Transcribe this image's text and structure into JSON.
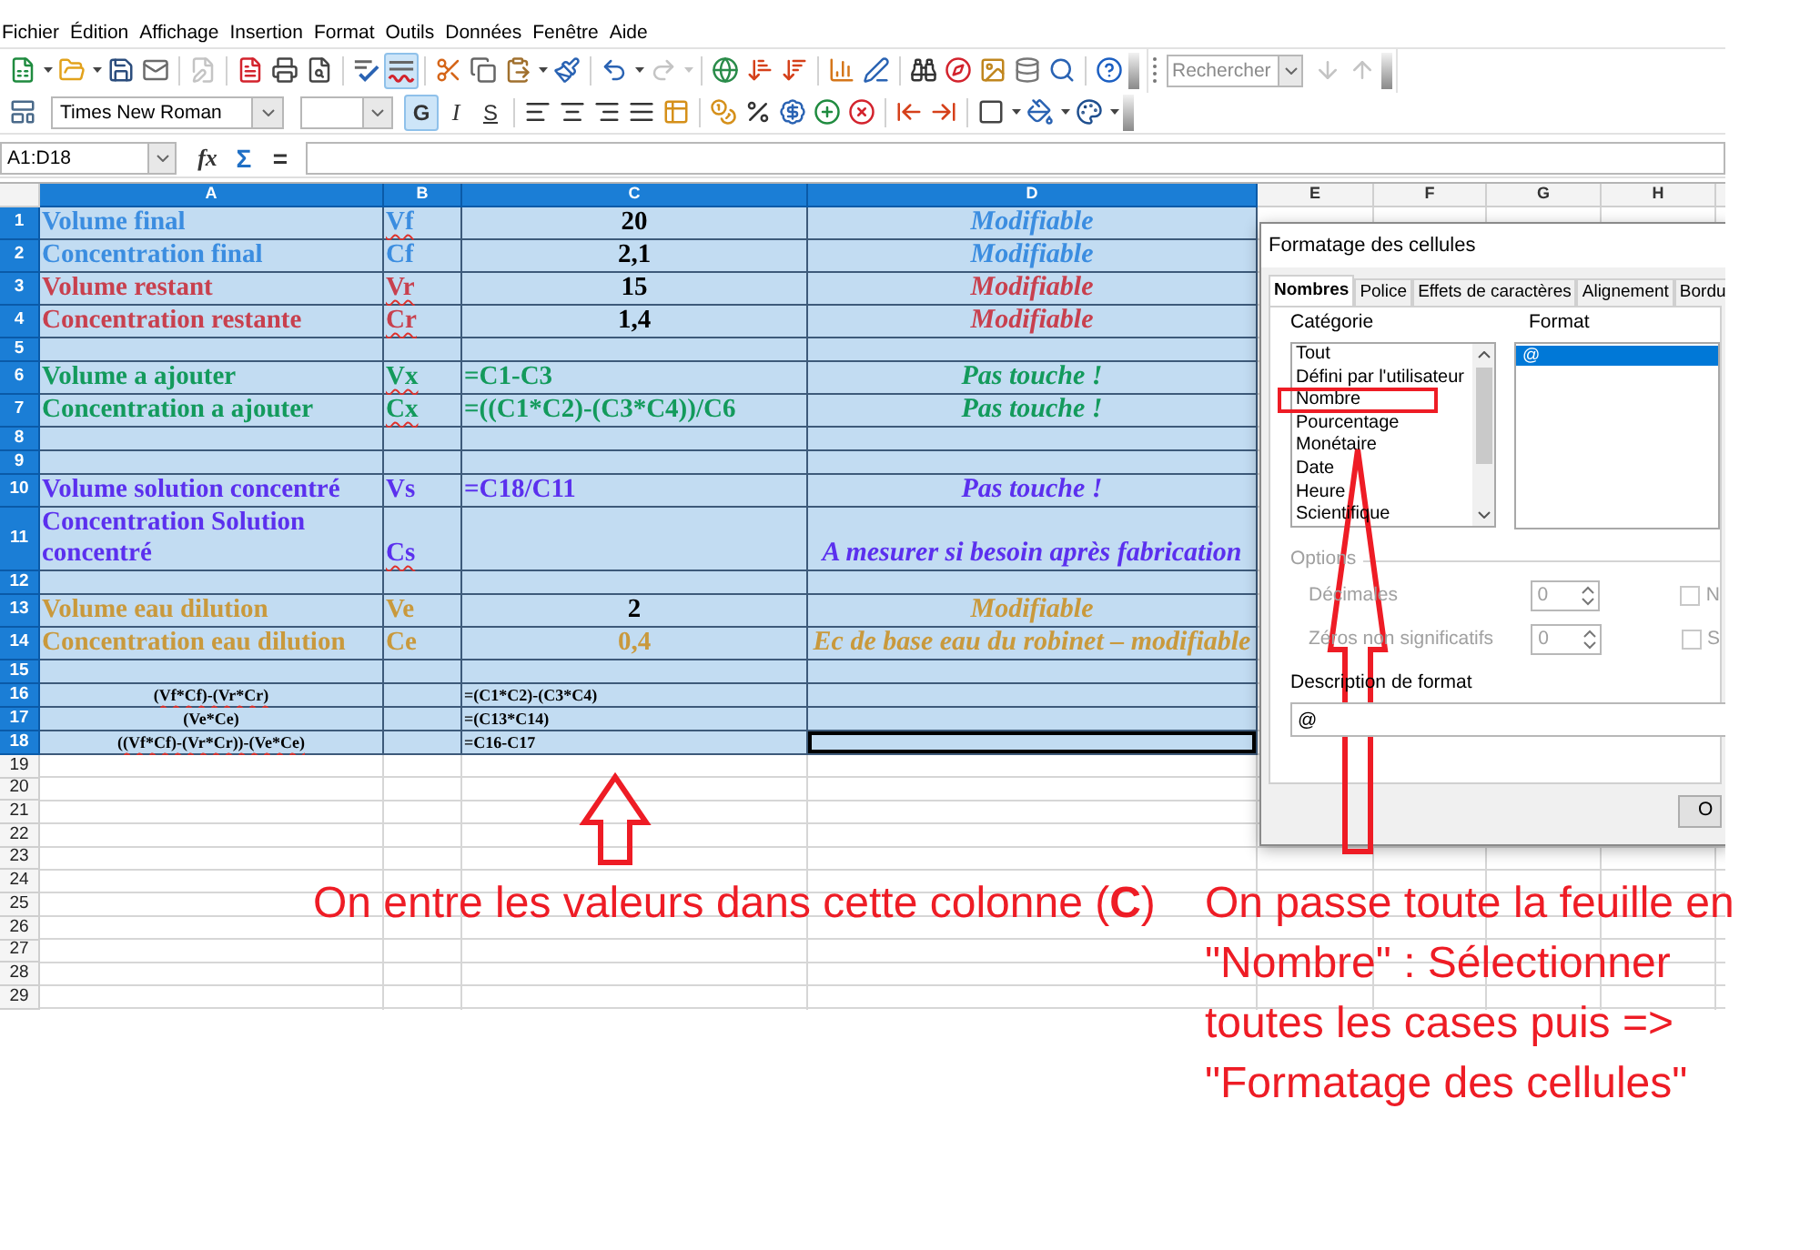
{
  "menu": [
    "Fichier",
    "Édition",
    "Affichage",
    "Insertion",
    "Format",
    "Outils",
    "Données",
    "Fenêtre",
    "Aide"
  ],
  "standard_toolbar": {
    "buttons": [
      {
        "active": false,
        "disabled": false
      },
      {
        "active": false,
        "disabled": false
      },
      {
        "active": false,
        "disabled": false
      },
      {
        "active": false,
        "disabled": false
      },
      {
        "active": false,
        "disabled": true
      },
      {
        "active": false,
        "disabled": false
      },
      {
        "active": false,
        "disabled": false
      },
      {
        "active": false,
        "disabled": false
      },
      {
        "active": false,
        "disabled": false
      },
      {
        "active": true,
        "disabled": false
      },
      {
        "active": false,
        "disabled": false
      },
      {
        "active": false,
        "disabled": false
      },
      {
        "active": false,
        "disabled": false
      },
      {
        "active": false,
        "disabled": false
      },
      {
        "active": false,
        "disabled": false
      },
      {
        "active": false,
        "disabled": true
      },
      {
        "active": false,
        "disabled": false
      },
      {
        "active": false,
        "disabled": false
      },
      {
        "active": false,
        "disabled": false
      },
      {
        "active": false,
        "disabled": false
      },
      {
        "active": false,
        "disabled": false
      },
      {
        "active": false,
        "disabled": false
      },
      {
        "active": false,
        "disabled": false
      },
      {
        "active": false,
        "disabled": false
      },
      {
        "active": false,
        "disabled": false
      },
      {
        "active": false,
        "disabled": false
      },
      {
        "active": false,
        "disabled": false
      }
    ]
  },
  "find_toolbar": {
    "placeholder": "Rechercher",
    "buttons": [
      {
        "disabled": true
      },
      {
        "disabled": true
      }
    ]
  },
  "formatting_toolbar": {
    "font_name": "Times New Roman",
    "style_buttons": [
      {
        "label": "G",
        "active": true
      },
      {
        "label": "I",
        "active": false
      },
      {
        "label": "S",
        "active": false
      }
    ]
  },
  "formula_bar": {
    "name_box": "A1:D18",
    "buttons": [
      {
        "label": "fx"
      },
      {
        "label": "Σ"
      },
      {
        "label": "="
      }
    ]
  },
  "sheet": {
    "columns": [
      {
        "label": "A",
        "selected": true
      },
      {
        "label": "B",
        "selected": true
      },
      {
        "label": "C",
        "selected": true
      },
      {
        "label": "D",
        "selected": true
      },
      {
        "label": "E",
        "selected": false
      },
      {
        "label": "F",
        "selected": false
      },
      {
        "label": "G",
        "selected": false
      },
      {
        "label": "H",
        "selected": false
      }
    ],
    "rows": [
      {
        "header": "1",
        "selected": true,
        "kind": "entry",
        "cells": [
          {
            "kind": "label",
            "text": "Volume final",
            "color": "#3b8de0",
            "flagged": false,
            "active": false
          },
          {
            "kind": "symbol",
            "text": "Vf",
            "color": "#3b8de0",
            "flagged": true,
            "active": false
          },
          {
            "kind": "value",
            "text": "20",
            "color": "#000000",
            "flagged": false,
            "active": false
          },
          {
            "kind": "note",
            "text": "Modifiable",
            "color": "#3b8de0",
            "flagged": false,
            "active": false
          }
        ]
      },
      {
        "header": "2",
        "selected": true,
        "kind": "entry",
        "cells": [
          {
            "kind": "label",
            "text": "Concentration final",
            "color": "#3b8de0",
            "flagged": false,
            "active": false
          },
          {
            "kind": "symbol",
            "text": "Cf",
            "color": "#3b8de0",
            "flagged": false,
            "active": false
          },
          {
            "kind": "value",
            "text": "2,1",
            "color": "#000000",
            "flagged": false,
            "active": false
          },
          {
            "kind": "note",
            "text": "Modifiable",
            "color": "#3b8de0",
            "flagged": false,
            "active": false
          }
        ]
      },
      {
        "header": "3",
        "selected": true,
        "kind": "entry",
        "cells": [
          {
            "kind": "label",
            "text": "Volume restant",
            "color": "#c8404e",
            "flagged": false,
            "active": false
          },
          {
            "kind": "symbol",
            "text": "Vr",
            "color": "#c8404e",
            "flagged": true,
            "active": false
          },
          {
            "kind": "value",
            "text": "15",
            "color": "#000000",
            "flagged": false,
            "active": false
          },
          {
            "kind": "note",
            "text": "Modifiable",
            "color": "#c8404e",
            "flagged": false,
            "active": false
          }
        ]
      },
      {
        "header": "4",
        "selected": true,
        "kind": "entry",
        "cells": [
          {
            "kind": "label",
            "text": "Concentration restante",
            "color": "#c8404e",
            "flagged": false,
            "active": false
          },
          {
            "kind": "symbol",
            "text": "Cr",
            "color": "#c8404e",
            "flagged": true,
            "active": false
          },
          {
            "kind": "value",
            "text": "1,4",
            "color": "#000000",
            "flagged": false,
            "active": false
          },
          {
            "kind": "note",
            "text": "Modifiable",
            "color": "#c8404e",
            "flagged": false,
            "active": false
          }
        ]
      },
      {
        "header": "5",
        "selected": true,
        "kind": "blank",
        "cells": [
          {
            "kind": "empty",
            "active": false
          },
          {
            "kind": "empty",
            "active": false
          },
          {
            "kind": "empty",
            "active": false
          },
          {
            "kind": "empty",
            "active": false
          }
        ]
      },
      {
        "header": "6",
        "selected": true,
        "kind": "entry",
        "cells": [
          {
            "kind": "label",
            "text": "Volume a ajouter",
            "color": "#139a5c",
            "flagged": false,
            "active": false
          },
          {
            "kind": "symbol",
            "text": "Vx",
            "color": "#139a5c",
            "flagged": true,
            "active": false
          },
          {
            "kind": "formula",
            "text": "=C1-C3",
            "color": "#139a5c",
            "flagged": false,
            "active": false
          },
          {
            "kind": "note",
            "text": "Pas touche !",
            "color": "#139a5c",
            "flagged": false,
            "active": false
          }
        ]
      },
      {
        "header": "7",
        "selected": true,
        "kind": "entry",
        "cells": [
          {
            "kind": "label",
            "text": "Concentration a ajouter",
            "color": "#139a5c",
            "flagged": false,
            "active": false
          },
          {
            "kind": "symbol",
            "text": "Cx",
            "color": "#139a5c",
            "flagged": true,
            "active": false
          },
          {
            "kind": "formula",
            "text": "=((C1*C2)-(C3*C4))/C6",
            "color": "#139a5c",
            "flagged": false,
            "active": false
          },
          {
            "kind": "note",
            "text": "Pas touche !",
            "color": "#139a5c",
            "flagged": false,
            "active": false
          }
        ]
      },
      {
        "header": "8",
        "selected": true,
        "kind": "blank",
        "cells": [
          {
            "kind": "empty",
            "active": false
          },
          {
            "kind": "empty",
            "active": false
          },
          {
            "kind": "empty",
            "active": false
          },
          {
            "kind": "empty",
            "active": false
          }
        ]
      },
      {
        "header": "9",
        "selected": true,
        "kind": "blank",
        "cells": [
          {
            "kind": "empty",
            "active": false
          },
          {
            "kind": "empty",
            "active": false
          },
          {
            "kind": "empty",
            "active": false
          },
          {
            "kind": "empty",
            "active": false
          }
        ]
      },
      {
        "header": "10",
        "selected": true,
        "kind": "entry",
        "cells": [
          {
            "kind": "label",
            "text": "Volume solution concentré",
            "color": "#5b30ee",
            "flagged": false,
            "active": false
          },
          {
            "kind": "symbol",
            "text": "Vs",
            "color": "#5b30ee",
            "flagged": false,
            "active": false
          },
          {
            "kind": "formula",
            "text": "=C18/C11",
            "color": "#5b30ee",
            "flagged": false,
            "active": false
          },
          {
            "kind": "note",
            "text": "Pas touche !",
            "color": "#5b30ee",
            "flagged": false,
            "active": false
          }
        ]
      },
      {
        "header": "11",
        "selected": true,
        "kind": "entry",
        "cells": [
          {
            "kind": "label",
            "text": "Concentration Solution concentré",
            "color": "#5b30ee",
            "flagged": false,
            "active": false
          },
          {
            "kind": "symbol",
            "text": "Cs",
            "color": "#5b30ee",
            "flagged": true,
            "active": false
          },
          {
            "kind": "empty",
            "active": false
          },
          {
            "kind": "note",
            "text": "A mesurer si besoin après fabrication",
            "color": "#5b30ee",
            "flagged": false,
            "active": false
          }
        ]
      },
      {
        "header": "12",
        "selected": true,
        "kind": "blank",
        "cells": [
          {
            "kind": "empty",
            "active": false
          },
          {
            "kind": "empty",
            "active": false
          },
          {
            "kind": "empty",
            "active": false
          },
          {
            "kind": "empty",
            "active": false
          }
        ]
      },
      {
        "header": "13",
        "selected": true,
        "kind": "entry",
        "cells": [
          {
            "kind": "label",
            "text": "Volume eau dilution",
            "color": "#c9993c",
            "flagged": false,
            "active": false
          },
          {
            "kind": "symbol",
            "text": "Ve",
            "color": "#c9993c",
            "flagged": false,
            "active": false
          },
          {
            "kind": "value",
            "text": "2",
            "color": "#000000",
            "flagged": false,
            "active": false
          },
          {
            "kind": "note",
            "text": "Modifiable",
            "color": "#c9993c",
            "flagged": false,
            "active": false
          }
        ]
      },
      {
        "header": "14",
        "selected": true,
        "kind": "entry",
        "cells": [
          {
            "kind": "label",
            "text": "Concentration eau dilution",
            "color": "#c9993c",
            "flagged": false,
            "active": false
          },
          {
            "kind": "symbol",
            "text": "Ce",
            "color": "#c9993c",
            "flagged": false,
            "active": false
          },
          {
            "kind": "value",
            "text": "0,4",
            "color": "#c9993c",
            "flagged": false,
            "active": false
          },
          {
            "kind": "note",
            "text": "Ec de base eau du robinet – modifiable",
            "color": "#c9993c",
            "flagged": false,
            "active": false
          }
        ]
      },
      {
        "header": "15",
        "selected": true,
        "kind": "blank",
        "cells": [
          {
            "kind": "empty",
            "active": false
          },
          {
            "kind": "empty",
            "active": false
          },
          {
            "kind": "empty",
            "active": false
          },
          {
            "kind": "empty",
            "active": false
          }
        ]
      },
      {
        "header": "16",
        "selected": true,
        "kind": "calc",
        "cells": [
          {
            "kind": "expression",
            "text": "(Vf*Cf)-(Vr*Cr)",
            "color": "#000000",
            "flagged": true,
            "active": false
          },
          {
            "kind": "empty",
            "active": false
          },
          {
            "kind": "formula",
            "text": "=(C1*C2)-(C3*C4)",
            "color": "#000000",
            "flagged": false,
            "active": false
          },
          {
            "kind": "empty",
            "active": false
          }
        ]
      },
      {
        "header": "17",
        "selected": true,
        "kind": "calc",
        "cells": [
          {
            "kind": "expression",
            "text": "(Ve*Ce)",
            "color": "#000000",
            "flagged": false,
            "active": false
          },
          {
            "kind": "empty",
            "active": false
          },
          {
            "kind": "formula",
            "text": "=(C13*C14)",
            "color": "#000000",
            "flagged": false,
            "active": false
          },
          {
            "kind": "empty",
            "active": false
          }
        ]
      },
      {
        "header": "18",
        "selected": true,
        "kind": "calc",
        "cells": [
          {
            "kind": "expression",
            "text": "((Vf*Cf)-(Vr*Cr))-(Ve*Ce)",
            "color": "#000000",
            "flagged": true,
            "active": false
          },
          {
            "kind": "empty",
            "active": false
          },
          {
            "kind": "formula",
            "text": "=C16-C17",
            "color": "#000000",
            "flagged": false,
            "active": false
          },
          {
            "kind": "empty",
            "active": true
          }
        ]
      },
      {
        "header": "19",
        "selected": false,
        "kind": "empty"
      },
      {
        "header": "20",
        "selected": false,
        "kind": "empty"
      },
      {
        "header": "21",
        "selected": false,
        "kind": "empty"
      },
      {
        "header": "22",
        "selected": false,
        "kind": "empty"
      },
      {
        "header": "23",
        "selected": false,
        "kind": "empty"
      },
      {
        "header": "24",
        "selected": false,
        "kind": "empty"
      },
      {
        "header": "25",
        "selected": false,
        "kind": "empty"
      },
      {
        "header": "26",
        "selected": false,
        "kind": "empty"
      },
      {
        "header": "27",
        "selected": false,
        "kind": "empty"
      },
      {
        "header": "28",
        "selected": false,
        "kind": "empty"
      },
      {
        "header": "29",
        "selected": false,
        "kind": "empty"
      }
    ]
  },
  "dialog": {
    "title": "Formatage des cellules",
    "tabs": [
      {
        "label": "Nombres",
        "selected": true
      },
      {
        "label": "Police",
        "selected": false
      },
      {
        "label": "Effets de caractères",
        "selected": false
      },
      {
        "label": "Alignement",
        "selected": false
      },
      {
        "label": "Bordu",
        "selected": false
      }
    ],
    "category": {
      "label": "Catégorie",
      "items": [
        {
          "label": "Tout",
          "selected": false
        },
        {
          "label": "Défini par l'utilisateur",
          "selected": false
        },
        {
          "label": "Nombre",
          "selected": false
        },
        {
          "label": "Pourcentage",
          "selected": false
        },
        {
          "label": "Monétaire",
          "selected": false
        },
        {
          "label": "Date",
          "selected": false
        },
        {
          "label": "Heure",
          "selected": false
        },
        {
          "label": "Scientifique",
          "selected": false
        }
      ]
    },
    "format": {
      "label": "Format",
      "items": [
        {
          "label": "@",
          "selected": true
        }
      ]
    },
    "options": {
      "label": "Options",
      "disabled": true,
      "fields": [
        {
          "label": "Décimales",
          "value": "0"
        },
        {
          "label": "Zéros non significatifs",
          "value": "0"
        }
      ],
      "checkboxes": [
        {
          "label": "N",
          "checked": false
        },
        {
          "label": "S",
          "checked": false
        }
      ]
    },
    "description": {
      "label": "Description de format",
      "value": "@"
    },
    "buttons": [
      {
        "label": "O"
      }
    ]
  },
  "annotations": [
    {
      "text": "On entre les valeurs dans cette colonne (**C**)"
    },
    {
      "text": "On passe toute la feuille en \"Nombre\" : Sélectionner toutes les cases puis => \"Formatage des cellules\""
    }
  ]
}
